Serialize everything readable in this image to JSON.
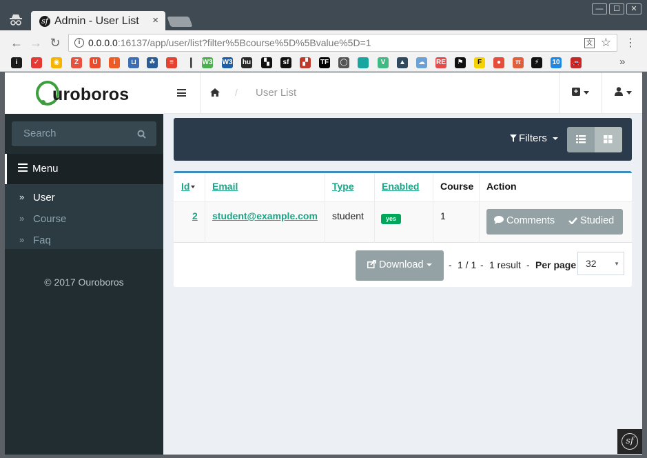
{
  "browser": {
    "tab_title": "Admin - User List",
    "tab_close": "×",
    "url_host": "0.0.0.0",
    "url_rest": ":16137/app/user/list?filter%5Bcourse%5D%5Bvalue%5D=1",
    "window_min": "—",
    "window_max": "☐",
    "window_close": "✕",
    "back": "←",
    "forward": "→",
    "reload": "↻",
    "star": "☆",
    "menu": "⋮",
    "bookmarks_more": "»",
    "bookmarks": [
      {
        "icon": "bm-1",
        "text": "i",
        "color": "#1a1a1a"
      },
      {
        "icon": "bm-check",
        "text": "✓",
        "color": "#e53935"
      },
      {
        "icon": "bm-bulb",
        "text": "◉",
        "color": "#f4b400"
      },
      {
        "icon": "bm-z",
        "text": "Z",
        "color": "#e8513f"
      },
      {
        "icon": "bm-u",
        "text": "U",
        "color": "#ea4c2b"
      },
      {
        "icon": "bm-i",
        "text": "i",
        "color": "#ef5b24"
      },
      {
        "icon": "bm-bucket",
        "text": "⊔",
        "color": "#3b6eb4"
      },
      {
        "icon": "bm-tree",
        "text": "☘",
        "color": "#2b5c95"
      },
      {
        "icon": "bm-todo",
        "text": "≡",
        "color": "#e44332"
      },
      {
        "icon": "bm-divider",
        "text": "|",
        "color": "#111111"
      },
      {
        "icon": "bm-w3",
        "text": "W3",
        "color": "#4caf50"
      },
      {
        "icon": "bm-w3c",
        "text": "W3",
        "color": "#1d5ea8"
      },
      {
        "icon": "bm-hu",
        "text": "hu",
        "color": "#2a2a2a"
      },
      {
        "icon": "bm-puzzle",
        "text": "▚",
        "color": "#111111"
      },
      {
        "icon": "bm-sf",
        "text": "sf",
        "color": "#111111"
      },
      {
        "icon": "bm-blocks",
        "text": "▞",
        "color": "#c0392b"
      },
      {
        "icon": "bm-tf",
        "text": "TF",
        "color": "#000000"
      },
      {
        "icon": "bm-chat",
        "text": "◯",
        "color": "#555555"
      },
      {
        "icon": "bm-teal",
        "text": "",
        "color": "#1aa6a0"
      },
      {
        "icon": "bm-vue",
        "text": "V",
        "color": "#42b883"
      },
      {
        "icon": "bm-nuxt",
        "text": "▲",
        "color": "#2f495e"
      },
      {
        "icon": "bm-cloud",
        "text": "☁",
        "color": "#6aa2d8"
      },
      {
        "icon": "bm-repo",
        "text": "RE",
        "color": "#e54b4b"
      },
      {
        "icon": "bm-flag",
        "text": "⚑",
        "color": "#111111"
      },
      {
        "icon": "bm-f",
        "text": "F",
        "color": "#f6d200"
      },
      {
        "icon": "bm-record",
        "text": "●",
        "color": "#e64c3c"
      },
      {
        "icon": "bm-pi",
        "text": "π",
        "color": "#e25d3b"
      },
      {
        "icon": "bm-bolt",
        "text": "⚡",
        "color": "#111111"
      },
      {
        "icon": "bm-10",
        "text": "10",
        "color": "#1e88e5"
      },
      {
        "icon": "bm-car",
        "text": "🚗",
        "color": "#c62828"
      }
    ]
  },
  "app": {
    "logo": "uroboros",
    "search_placeholder": "Search",
    "menu_label": "Menu",
    "menu_items": [
      {
        "label": "User",
        "active": true
      },
      {
        "label": "Course",
        "active": false
      },
      {
        "label": "Faq",
        "active": false
      }
    ],
    "copyright": "© 2017 Ouroboros",
    "breadcrumb_separator": "/",
    "breadcrumb_current": "User List",
    "filters_label": "Filters",
    "table": {
      "columns": [
        "Id",
        "Email",
        "Type",
        "Enabled",
        "Course",
        "Action"
      ],
      "rows": [
        {
          "id": "2",
          "email": "student@example.com",
          "type": "student",
          "enabled": "yes",
          "course": "1"
        }
      ],
      "actions": {
        "comments": "Comments",
        "studied": "Studied"
      }
    },
    "download_label": "Download",
    "pager": {
      "sep1": "-",
      "pages": "1 / 1",
      "sep2": "-",
      "results": "1 result",
      "sep3": "-",
      "per_page_label": "Per page",
      "per_page_value": "32"
    }
  },
  "colors": {
    "accent": "#3c8dbc",
    "link": "#1aa587",
    "sidebar": "#222d32",
    "filterbar": "#2c3b4b",
    "button": "#94a2a5",
    "success": "#00a65a"
  }
}
